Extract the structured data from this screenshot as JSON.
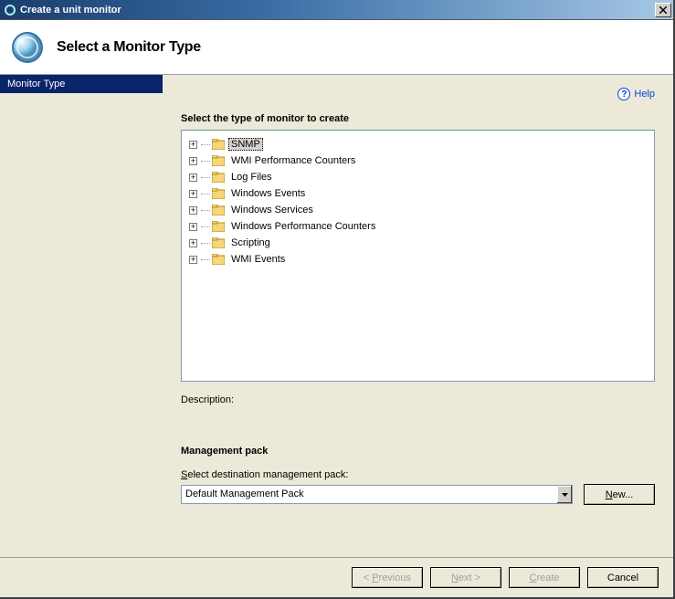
{
  "titlebar": {
    "title": "Create a unit monitor"
  },
  "header": {
    "title": "Select a Monitor Type"
  },
  "sidebar": {
    "items": [
      {
        "label": "Monitor Type",
        "selected": true
      }
    ]
  },
  "help": {
    "label": "Help"
  },
  "content": {
    "tree_label": "Select the type of monitor to create",
    "tree_items": [
      {
        "label": "SNMP",
        "selected": true
      },
      {
        "label": "WMI Performance Counters"
      },
      {
        "label": "Log Files"
      },
      {
        "label": "Windows Events"
      },
      {
        "label": "Windows Services"
      },
      {
        "label": "Windows Performance Counters"
      },
      {
        "label": "Scripting"
      },
      {
        "label": "WMI Events"
      }
    ],
    "description_label": "Description:"
  },
  "management_pack": {
    "header": "Management pack",
    "sublabel_pre": "S",
    "sublabel_post": "elect destination management pack:",
    "selected": "Default Management Pack",
    "new_button": "New..."
  },
  "buttons": {
    "previous_pre": "< ",
    "previous_ul": "P",
    "previous_post": "revious",
    "next_ul": "N",
    "next_post": "ext >",
    "create_ul": "C",
    "create_post": "reate",
    "cancel": "Cancel"
  }
}
